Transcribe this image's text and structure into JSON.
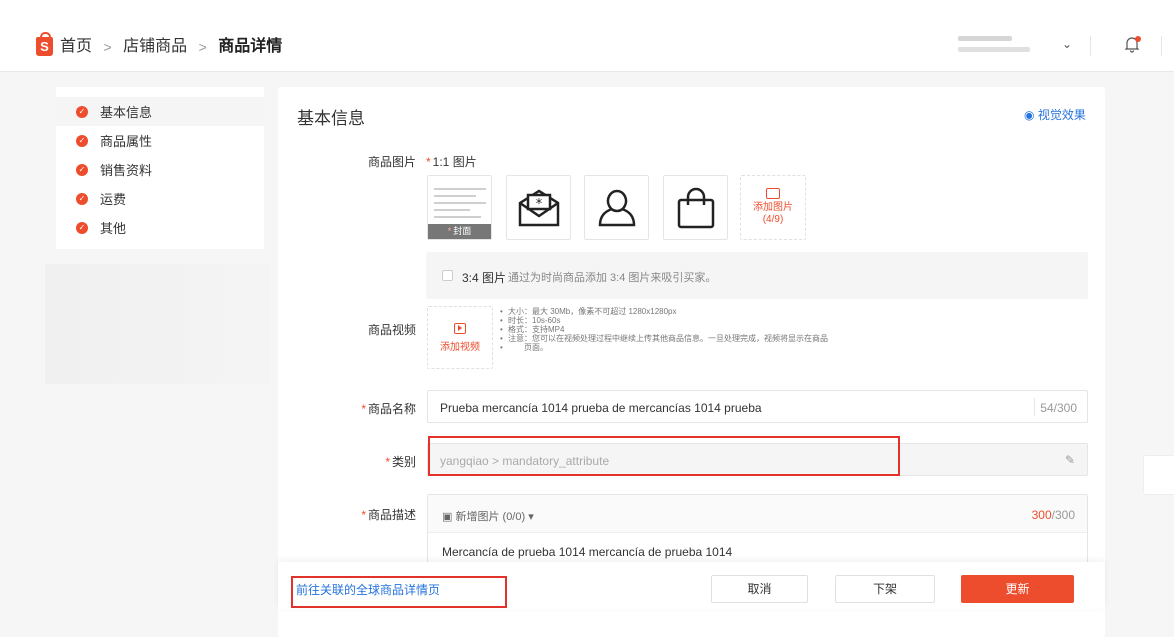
{
  "breadcrumb": {
    "home": "首页",
    "products": "店铺商品",
    "current": "商品详情"
  },
  "sidebar": {
    "items": [
      {
        "label": "基本信息"
      },
      {
        "label": "商品属性"
      },
      {
        "label": "销售资料"
      },
      {
        "label": "运费"
      },
      {
        "label": "其他"
      }
    ]
  },
  "main": {
    "section_title": "基本信息",
    "preview_link": "视觉效果",
    "images": {
      "label": "商品图片",
      "ratio_tag": "1:1 图片",
      "cover_badge": "封面",
      "add_label": "添加图片",
      "add_count": "(4/9)",
      "ratio34_label": "3:4 图片",
      "ratio34_hint": "通过为时尚商品添加 3:4 图片来吸引买家。"
    },
    "video": {
      "label": "商品视频",
      "add_label": "添加视频",
      "rules": [
        "大小：最大 30Mb，像素不可超过 1280x1280px",
        "时长：10s-60s",
        "格式：支持MP4",
        "注意：您可以在视频处理过程中继续上传其他商品信息。一旦处理完成，视频将显示在商品",
        "页面。"
      ]
    },
    "name": {
      "label": "商品名称",
      "value": "Prueba mercancía 1014 prueba de mercancías 1014 prueba",
      "counter": "54/300"
    },
    "category": {
      "label": "类别",
      "value": "yangqiao > mandatory_attribute"
    },
    "description": {
      "label": "商品描述",
      "insert_image": "新增图片 (0/0)",
      "counter_current": "300",
      "counter_total": "/300",
      "text": "Mercancía de prueba 1014 mercancía de prueba 1014"
    }
  },
  "footer": {
    "global_link": "前往关联的全球商品详情页",
    "cancel": "取消",
    "delist": "下架",
    "update": "更新"
  },
  "colors": {
    "brand": "#ee4d2d",
    "link": "#2673dd",
    "highlight": "#e2332b"
  }
}
